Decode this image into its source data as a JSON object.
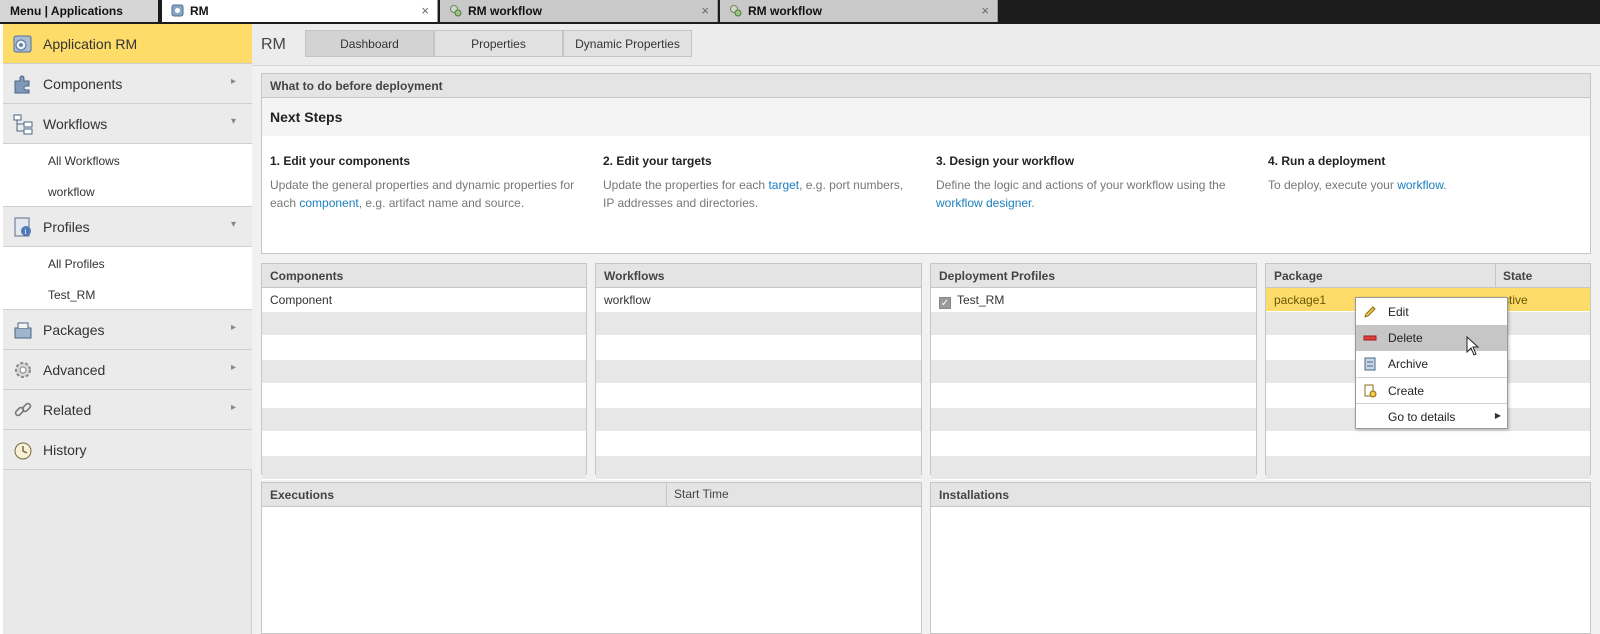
{
  "topbar": {
    "menu_label": "Menu | Applications",
    "tabs": [
      {
        "label": "RM",
        "active": true
      },
      {
        "label": "RM workflow",
        "active": false
      },
      {
        "label": "RM workflow",
        "active": false
      }
    ],
    "close_glyph": "×"
  },
  "sidebar": {
    "items": [
      {
        "label": "Application RM",
        "icon": "application-icon",
        "active": true
      },
      {
        "label": "Components",
        "icon": "puzzle-icon",
        "arrow": "▸"
      },
      {
        "label": "Workflows",
        "icon": "workflow-icon",
        "arrow": "▾",
        "children": [
          "All Workflows",
          "workflow"
        ]
      },
      {
        "label": "Profiles",
        "icon": "profile-icon",
        "arrow": "▾",
        "children": [
          "All Profiles",
          "Test_RM"
        ]
      },
      {
        "label": "Packages",
        "icon": "package-icon",
        "arrow": "▸"
      },
      {
        "label": "Advanced",
        "icon": "gear-icon",
        "arrow": "▸"
      },
      {
        "label": "Related",
        "icon": "link-icon",
        "arrow": "▸"
      },
      {
        "label": "History",
        "icon": "clock-icon"
      }
    ]
  },
  "header": {
    "app_name": "RM",
    "tabs": [
      "Dashboard",
      "Properties",
      "Dynamic Properties"
    ],
    "active_tab": "Dashboard"
  },
  "info": {
    "heading": "What to do before deployment",
    "subheading": "Next Steps",
    "steps": [
      {
        "title": "1. Edit your components",
        "pre": "Update the general properties and dynamic properties for each ",
        "link": "component",
        "post": ", e.g. artifact name and source."
      },
      {
        "title": "2. Edit your targets",
        "pre": "Update the properties for each ",
        "link": "target",
        "post": ", e.g. port numbers, IP addresses and directories."
      },
      {
        "title": "3. Design your workflow",
        "pre": "Define the logic and actions of your workflow using the ",
        "link": "workflow designer",
        "post": "."
      },
      {
        "title": "4. Run a deployment",
        "pre": "To deploy, execute your ",
        "link": "workflow",
        "post": "."
      }
    ]
  },
  "panels": {
    "components": {
      "header": "Components",
      "rows": [
        "Component"
      ]
    },
    "workflows": {
      "header": "Workflows",
      "rows": [
        "workflow"
      ]
    },
    "profiles": {
      "header": "Deployment Profiles",
      "rows": [
        "Test_RM"
      ],
      "checked": "✓"
    },
    "packages": {
      "header": "Package",
      "state_header": "State",
      "rows": [
        {
          "name": "package1",
          "state": "ctive"
        }
      ]
    },
    "executions": {
      "header": "Executions",
      "start_time_header": "Start Time"
    },
    "installations": {
      "header": "Installations"
    }
  },
  "context_menu": {
    "items": [
      {
        "label": "Edit",
        "icon": "pencil-icon"
      },
      {
        "label": "Delete",
        "icon": "delete-icon",
        "hover": true
      },
      {
        "label": "Archive",
        "icon": "archive-icon"
      },
      {
        "label": "Create",
        "icon": "create-icon"
      },
      {
        "label": "Go to details",
        "arrow": "▶"
      }
    ]
  },
  "colors": {
    "accent": "#fddc6a",
    "link": "#1a7fbf",
    "delete": "#e04040"
  }
}
